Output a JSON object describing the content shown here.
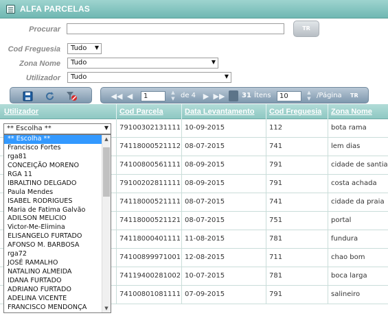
{
  "window": {
    "title": "ALFA PARCELAS"
  },
  "filters": {
    "search_label": "Procurar",
    "search_value": "",
    "search_button": "TR",
    "freguesia_label": "Cod Freguesia",
    "freguesia_value": "Tudo",
    "zona_label": "Zona Nome",
    "zona_value": "Tudo",
    "utilizador_label": "Utilizador",
    "utilizador_value": "Tudo"
  },
  "toolbar": {
    "icons": [
      "save-icon",
      "refresh-icon",
      "clear-filter-icon"
    ],
    "page_value": "1",
    "of_pages": "de 4",
    "item_count": "31",
    "items_label": "Ítens",
    "per_page_value": "10",
    "per_page_label": "/Página",
    "apply_button": "TR"
  },
  "grid": {
    "columns": [
      "Utilizador",
      "Cod Parcela",
      "Data Levantamento",
      "Cod Freguesia",
      "Zona Nome"
    ],
    "rows": [
      {
        "cod_parcela": "79100302131111",
        "data": "10-09-2015",
        "cod_freguesia": "112",
        "zona": "bota rama"
      },
      {
        "cod_parcela": "74118000521112",
        "data": "08-07-2015",
        "cod_freguesia": "741",
        "zona": "lem dias"
      },
      {
        "cod_parcela": "74100800561111",
        "data": "08-09-2015",
        "cod_freguesia": "791",
        "zona": "cidade de santia"
      },
      {
        "cod_parcela": "79100202811111",
        "data": "08-09-2015",
        "cod_freguesia": "791",
        "zona": "costa achada"
      },
      {
        "cod_parcela": "74118000521111",
        "data": "08-07-2015",
        "cod_freguesia": "741",
        "zona": "cidade da praia"
      },
      {
        "cod_parcela": "74118000521121",
        "data": "08-07-2015",
        "cod_freguesia": "751",
        "zona": "portal"
      },
      {
        "cod_parcela": "74118000401111",
        "data": "11-08-2015",
        "cod_freguesia": "781",
        "zona": "fundura"
      },
      {
        "cod_parcela": "74100899971001",
        "data": "12-08-2015",
        "cod_freguesia": "711",
        "zona": "chao bom"
      },
      {
        "cod_parcela": "74119400281002",
        "data": "10-07-2015",
        "cod_freguesia": "781",
        "zona": "boca larga"
      },
      {
        "cod_parcela": "74100801081111",
        "data": "07-09-2015",
        "cod_freguesia": "791",
        "zona": "salineiro"
      }
    ]
  },
  "user_dropdown": {
    "selected": "** Escolha **",
    "options": [
      "** Escolha **",
      "Francisco Fortes",
      "rga81",
      "CONCEIÇÃO MORENO",
      "RGA 11",
      "IBRALTINO DELGADO",
      "Paula Mendes",
      "ISABEL RODRIGUES",
      "Maria de Fatima Galvão",
      "ADILSON MELICIO",
      "Victor-Me-Elimina",
      "ELISANGELO FURTADO",
      "AFONSO M. BARBOSA",
      "rga72",
      "JOSÉ RAMALHO",
      "NATALINO ALMEIDA",
      "IDANA FURTADO",
      "ADRIANO FURTADO",
      "ADELINA VICENTE",
      "FRANCISCO MENDONÇA"
    ]
  }
}
